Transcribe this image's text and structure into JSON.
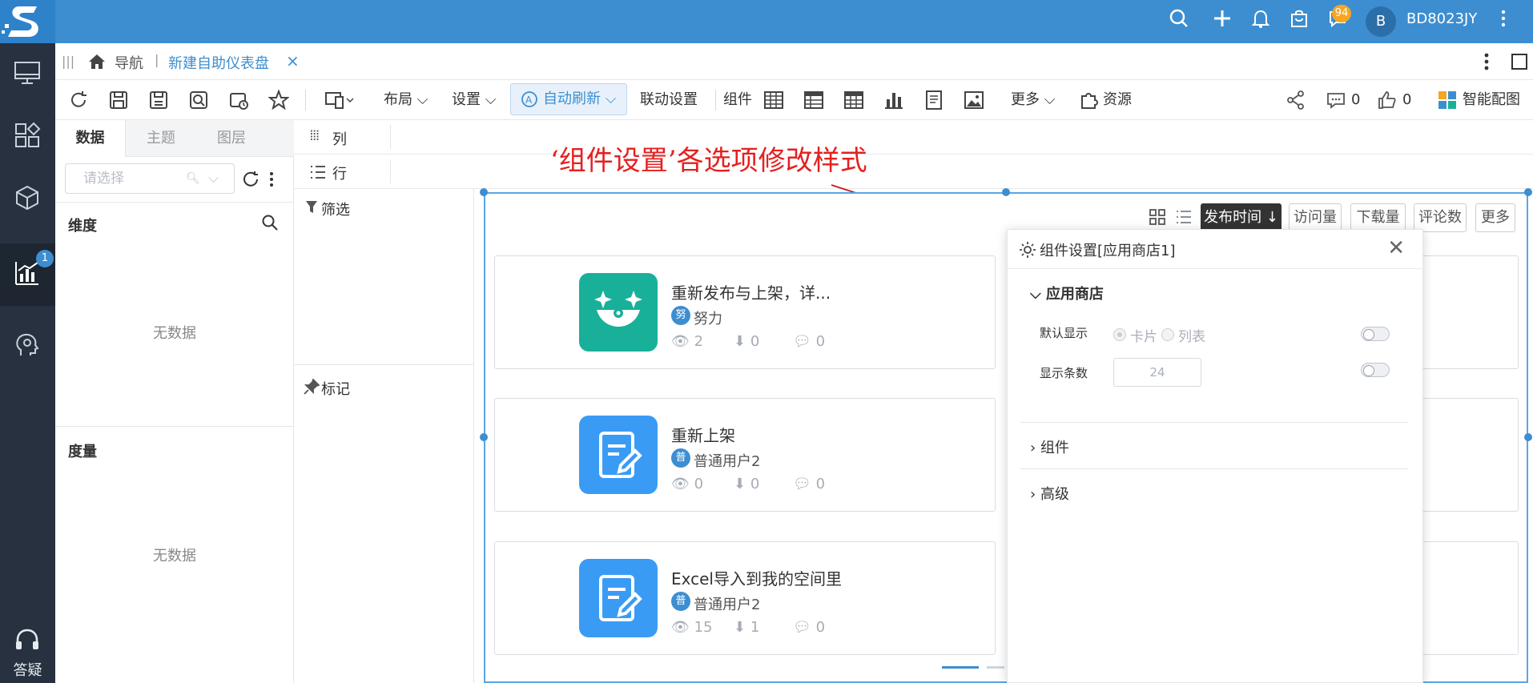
{
  "topbar": {
    "username": "BD8023JY",
    "avatar_letter": "B",
    "message_badge": "94",
    "logo": "S"
  },
  "rail": {
    "analysis_badge": "1",
    "help_label": "答疑"
  },
  "tabbar": {
    "nav_label": "导航",
    "sep": "|",
    "active_tab": "新建自助仪表盘",
    "close": "×"
  },
  "toolbar": {
    "layout_label": "布局",
    "settings_label": "设置",
    "auto_refresh_label": "自动刷新",
    "linkage_label": "联动设置",
    "component_label": "组件",
    "more_label": "更多",
    "resource_label": "资源",
    "comment_count": "0",
    "like_count": "0",
    "smart_label": "智能配图"
  },
  "left_panel": {
    "tabs": [
      "数据",
      "主题",
      "图层"
    ],
    "select_placeholder": "请选择",
    "dimension_title": "维度",
    "measure_title": "度量",
    "no_data": "无数据"
  },
  "shelves": {
    "columns_label": "列",
    "rows_label": "行"
  },
  "filter_pane": {
    "filter_label": "筛选",
    "mark_label": "标记"
  },
  "annotation": "‘组件设置’各选项修改样式",
  "sort_bar": {
    "publish_time": "发布时间 ↓",
    "views": "访问量",
    "downloads": "下载量",
    "comments": "评论数",
    "more": "更多"
  },
  "cards": [
    {
      "title": "重新发布与上架，详...",
      "user_char": "努",
      "user": "努力",
      "views": "2",
      "downloads": "0",
      "comments": "0",
      "color": "#19b09a"
    },
    {
      "title": "重新上架",
      "user_char": "普",
      "user": "普通用户2",
      "views": "0",
      "downloads": "0",
      "comments": "0",
      "color": "#3a9bf5"
    },
    {
      "title": "Excel导入到我的空间里",
      "user_char": "普",
      "user": "普通用户2",
      "views": "15",
      "downloads": "1",
      "comments": "0",
      "color": "#3a9bf5"
    }
  ],
  "settings_panel": {
    "title": "组件设置[应用商店1]",
    "close": "✕",
    "group_store": "应用商店",
    "default_display_label": "默认显示",
    "option_card": "卡片",
    "option_list": "列表",
    "count_label": "显示条数",
    "count_value": "24",
    "group_component": "组件",
    "group_advanced": "高级"
  },
  "colors": {
    "topbar": "#3d8ed0",
    "rail": "#27313f",
    "accent": "#3d8ed0",
    "annotation": "#e52020"
  }
}
